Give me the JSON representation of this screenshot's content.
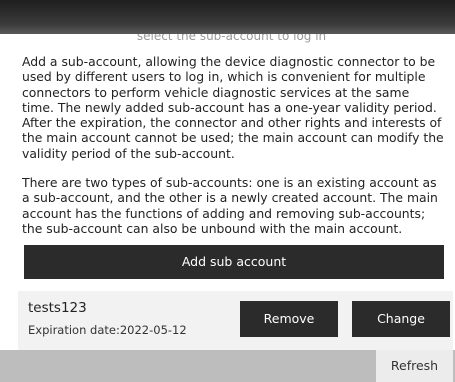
{
  "dialog": {
    "subtitle": "select the sub-account to log in",
    "paragraph_1": "Add a sub-account, allowing the device diagnostic connector to be used by different users to log in, which is convenient for multiple connectors to perform vehicle diagnostic services at the same time. The newly added sub-account has a one-year validity period. After the expiration, the connector and other rights and interests of the main account cannot be used; the main account can modify the validity period of the sub-account.",
    "paragraph_2": "There are two types of sub-accounts: one is an existing account as a sub-account, and the other is a newly created account. The main account has the functions of adding and removing sub-accounts; the sub-account can also be unbound with the main account.",
    "add_button_label": "Add sub account"
  },
  "accounts": [
    {
      "name": "tests123",
      "expiration": "Expiration date:2022-05-12",
      "remove_label": "Remove",
      "change_label": "Change"
    }
  ],
  "footer": {
    "refresh_label": "Refresh"
  }
}
